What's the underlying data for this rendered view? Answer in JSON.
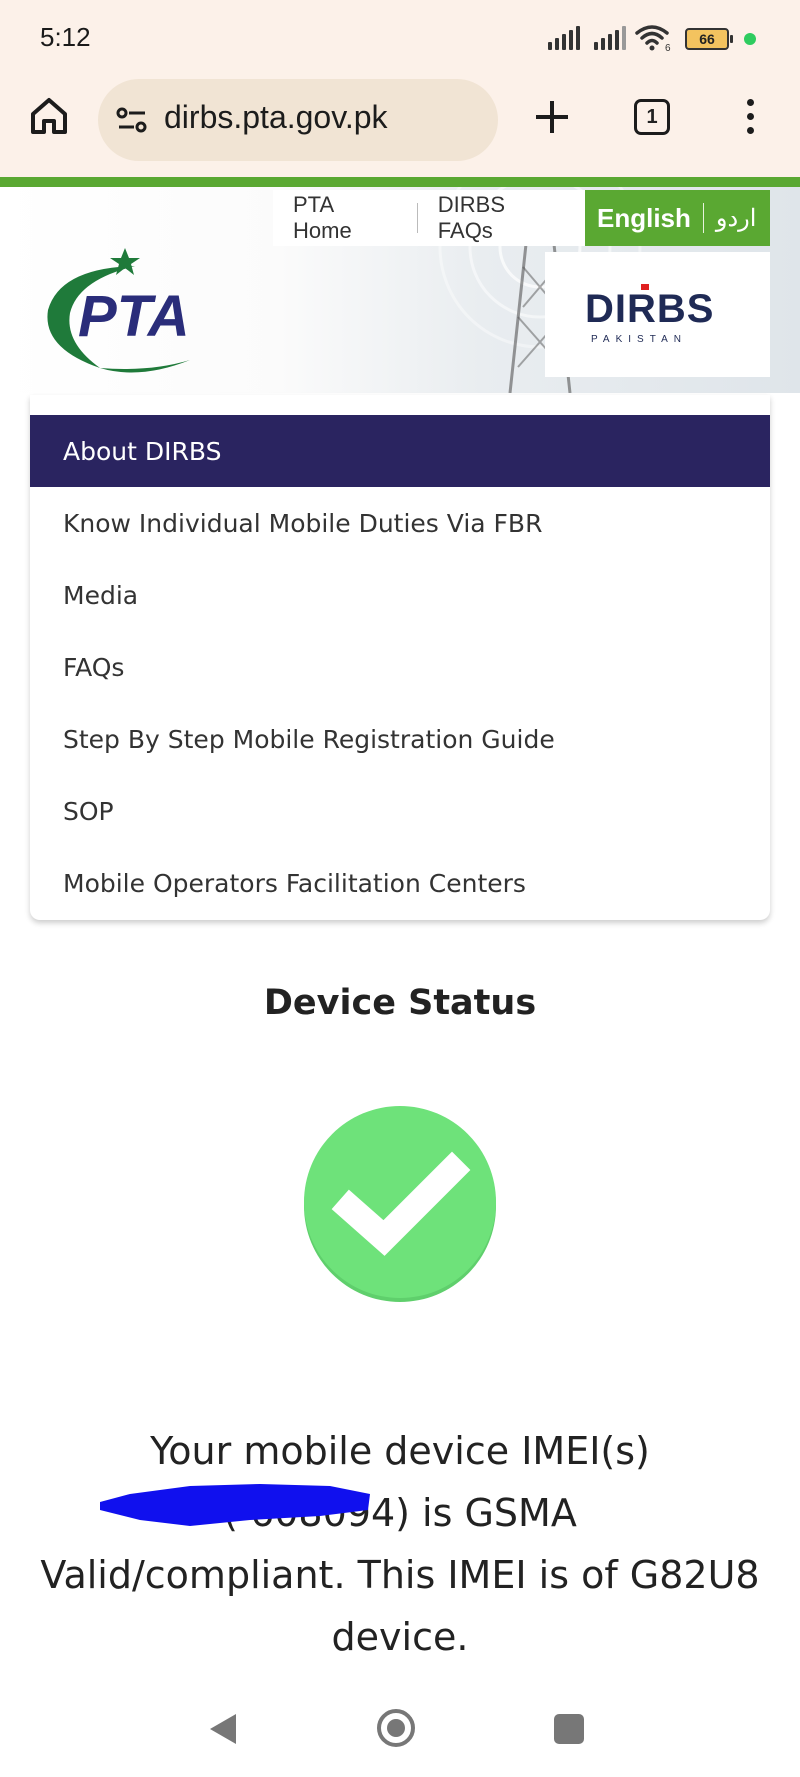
{
  "status_bar": {
    "time": "5:12",
    "battery": "66",
    "wifi_label": "6",
    "icons": [
      "signal-icon",
      "signal-icon",
      "wifi-icon",
      "battery-icon",
      "privacy-dot-icon"
    ]
  },
  "browser": {
    "url": "dirbs.pta.gov.pk",
    "tab_count": "1",
    "icons": [
      "home-icon",
      "site-settings-icon",
      "new-tab-icon",
      "tabs-icon",
      "overflow-menu-icon"
    ]
  },
  "site_header": {
    "nav": [
      {
        "label": "PTA Home"
      },
      {
        "label": "DIRBS FAQs"
      }
    ],
    "lang_en": "English",
    "lang_ur": "اردو",
    "pta_logo_text": "PTA",
    "dirbs_logo_text": "DIRBS",
    "dirbs_logo_sub": "PAKISTAN"
  },
  "menu": {
    "items": [
      {
        "label": "About DIRBS",
        "active": true
      },
      {
        "label": "Know Individual Mobile Duties Via FBR"
      },
      {
        "label": "Media"
      },
      {
        "label": "FAQs"
      },
      {
        "label": "Step By Step Mobile Registration Guide"
      },
      {
        "label": "SOP"
      },
      {
        "label": "Mobile Operators Facilitation Centers"
      }
    ]
  },
  "device_status": {
    "title": "Device Status",
    "line1": "Your mobile device IMEI(s)",
    "line2": "(        608094) is GSMA",
    "line3": "Valid/compliant. This IMEI is of G82U8",
    "line4": "device.",
    "icon": "check-circle-icon",
    "status_color": "#6ee27a"
  },
  "colors": {
    "brand_green": "#5aa832",
    "menu_active": "#2a2460",
    "redaction": "#1010ee"
  }
}
